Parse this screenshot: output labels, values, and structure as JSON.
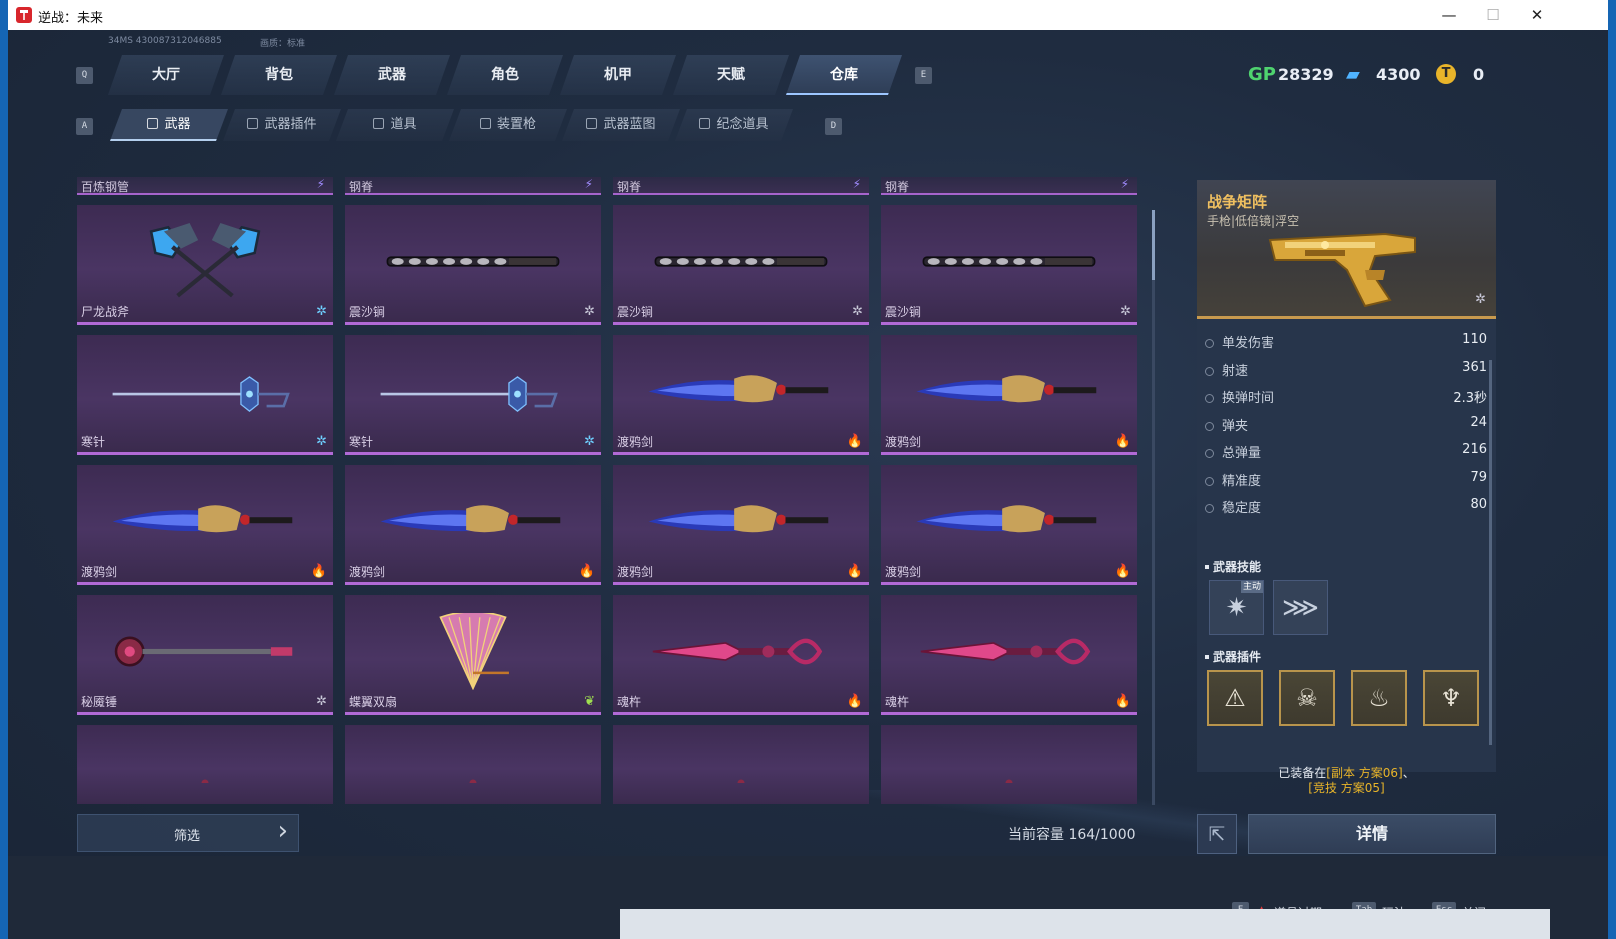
{
  "window": {
    "title": "逆战：未来",
    "minimize": "—",
    "maximize": "☐",
    "close": "✕"
  },
  "top_info": {
    "ping_id": "34MS  430087312046885",
    "quality": "画质：标准"
  },
  "keys": {
    "q": "Q",
    "e": "E",
    "a": "A",
    "d": "D",
    "f": "F",
    "tab": "Tab",
    "esc": "Esc"
  },
  "main_tabs": [
    "大厅",
    "背包",
    "武器",
    "角色",
    "机甲",
    "天赋",
    "仓库"
  ],
  "main_tab_active": "仓库",
  "currencies": [
    {
      "icon": "gp-icon",
      "symbol": "GP",
      "value": "28329",
      "color": "#4fd36f"
    },
    {
      "icon": "ticket-icon",
      "symbol": "▰",
      "value": "4300",
      "color": "#4fb3ff"
    },
    {
      "icon": "coin-icon",
      "symbol": "T",
      "value": "0",
      "color": "#e8b42a"
    }
  ],
  "sub_tabs": [
    "武器",
    "武器插件",
    "道具",
    "装置枪",
    "武器蓝图",
    "纪念道具"
  ],
  "sub_tab_active": "武器",
  "top_strip": [
    {
      "name": "百炼钢管",
      "badge": "⚡"
    },
    {
      "name": "钢脊",
      "badge": "⚡"
    },
    {
      "name": "钢脊",
      "badge": "⚡"
    },
    {
      "name": "钢脊",
      "badge": "⚡"
    }
  ],
  "weapons": [
    {
      "name": "尸龙战斧",
      "badge": "✲",
      "badge_color": "#6fd0ff",
      "art": "axes"
    },
    {
      "name": "震沙锏",
      "badge": "✲",
      "badge_color": "#c8c8d8",
      "art": "mace"
    },
    {
      "name": "震沙锏",
      "badge": "✲",
      "badge_color": "#c8c8d8",
      "art": "mace"
    },
    {
      "name": "震沙锏",
      "badge": "✲",
      "badge_color": "#c8c8d8",
      "art": "mace"
    },
    {
      "name": "寒针",
      "badge": "✲",
      "badge_color": "#6fd0ff",
      "art": "needle"
    },
    {
      "name": "寒针",
      "badge": "✲",
      "badge_color": "#6fd0ff",
      "art": "needle"
    },
    {
      "name": "渡鸦剑",
      "badge": "🔥",
      "badge_color": "#ffa020",
      "art": "raven"
    },
    {
      "name": "渡鸦剑",
      "badge": "🔥",
      "badge_color": "#ffa020",
      "art": "raven"
    },
    {
      "name": "渡鸦剑",
      "badge": "🔥",
      "badge_color": "#ffa020",
      "art": "raven"
    },
    {
      "name": "渡鸦剑",
      "badge": "🔥",
      "badge_color": "#ffa020",
      "art": "raven"
    },
    {
      "name": "渡鸦剑",
      "badge": "🔥",
      "badge_color": "#ffa020",
      "art": "raven"
    },
    {
      "name": "渡鸦剑",
      "badge": "🔥",
      "badge_color": "#ffa020",
      "art": "raven"
    },
    {
      "name": "秘魇锤",
      "badge": "✲",
      "badge_color": "#c8c8d8",
      "art": "hammer"
    },
    {
      "name": "蝶翼双扇",
      "badge": "❦",
      "badge_color": "#9fe050",
      "art": "fan"
    },
    {
      "name": "魂杵",
      "badge": "🔥",
      "badge_color": "#ffa020",
      "art": "pestle"
    },
    {
      "name": "魂杵",
      "badge": "🔥",
      "badge_color": "#ffa020",
      "art": "pestle"
    },
    {
      "name": "",
      "badge": "",
      "badge_color": "#c8c8d8",
      "art": "partial"
    },
    {
      "name": "",
      "badge": "",
      "badge_color": "#c8c8d8",
      "art": "partial"
    },
    {
      "name": "",
      "badge": "",
      "badge_color": "#c8c8d8",
      "art": "partial"
    },
    {
      "name": "",
      "badge": "",
      "badge_color": "#c8c8d8",
      "art": "partial"
    }
  ],
  "filter": {
    "label": "筛选",
    "arrow": "›"
  },
  "capacity": "当前容量 164/1000",
  "detail": {
    "name": "战争矩阵",
    "tags": "手枪|低倍镜|浮空",
    "badge": "✲",
    "stats": [
      {
        "label": "单发伤害",
        "value": "110"
      },
      {
        "label": "射速",
        "value": "361"
      },
      {
        "label": "换弹时间",
        "value": "2.3秒"
      },
      {
        "label": "弹夹",
        "value": "24"
      },
      {
        "label": "总弹量",
        "value": "216"
      },
      {
        "label": "精准度",
        "value": "79"
      },
      {
        "label": "稳定度",
        "value": "80"
      }
    ],
    "skills_title": "武器技能",
    "skill_tag": "主动",
    "skills": [
      {
        "icon": "burst-skill-icon",
        "glyph": "✷"
      },
      {
        "icon": "wave-skill-icon",
        "glyph": "⋙"
      }
    ],
    "plugins_title": "武器插件",
    "plugins": [
      {
        "icon": "warning-plugin-icon",
        "glyph": "⚠"
      },
      {
        "icon": "skull-plugin-icon",
        "glyph": "☠"
      },
      {
        "icon": "flame-plugin-icon",
        "glyph": "♨"
      },
      {
        "icon": "spirit-plugin-icon",
        "glyph": "♆"
      }
    ],
    "equipped_prefix": "已装备在",
    "equipped_1": "[副本 方案06]",
    "equipped_sep": "、",
    "equipped_2": "[竞技 方案05]"
  },
  "share_glyph": "⇱",
  "detail_button": "详情",
  "footer": {
    "expired_icon": "▲",
    "expired": "道具过期",
    "play": "玩法",
    "close": "关闭"
  },
  "colors": {
    "accent": "#9dc6ff",
    "rarity_purple": "#b16ad6",
    "gold": "#c89a4e",
    "equipped_gold": "#e8b42a",
    "warning_red": "#e23b3b"
  }
}
